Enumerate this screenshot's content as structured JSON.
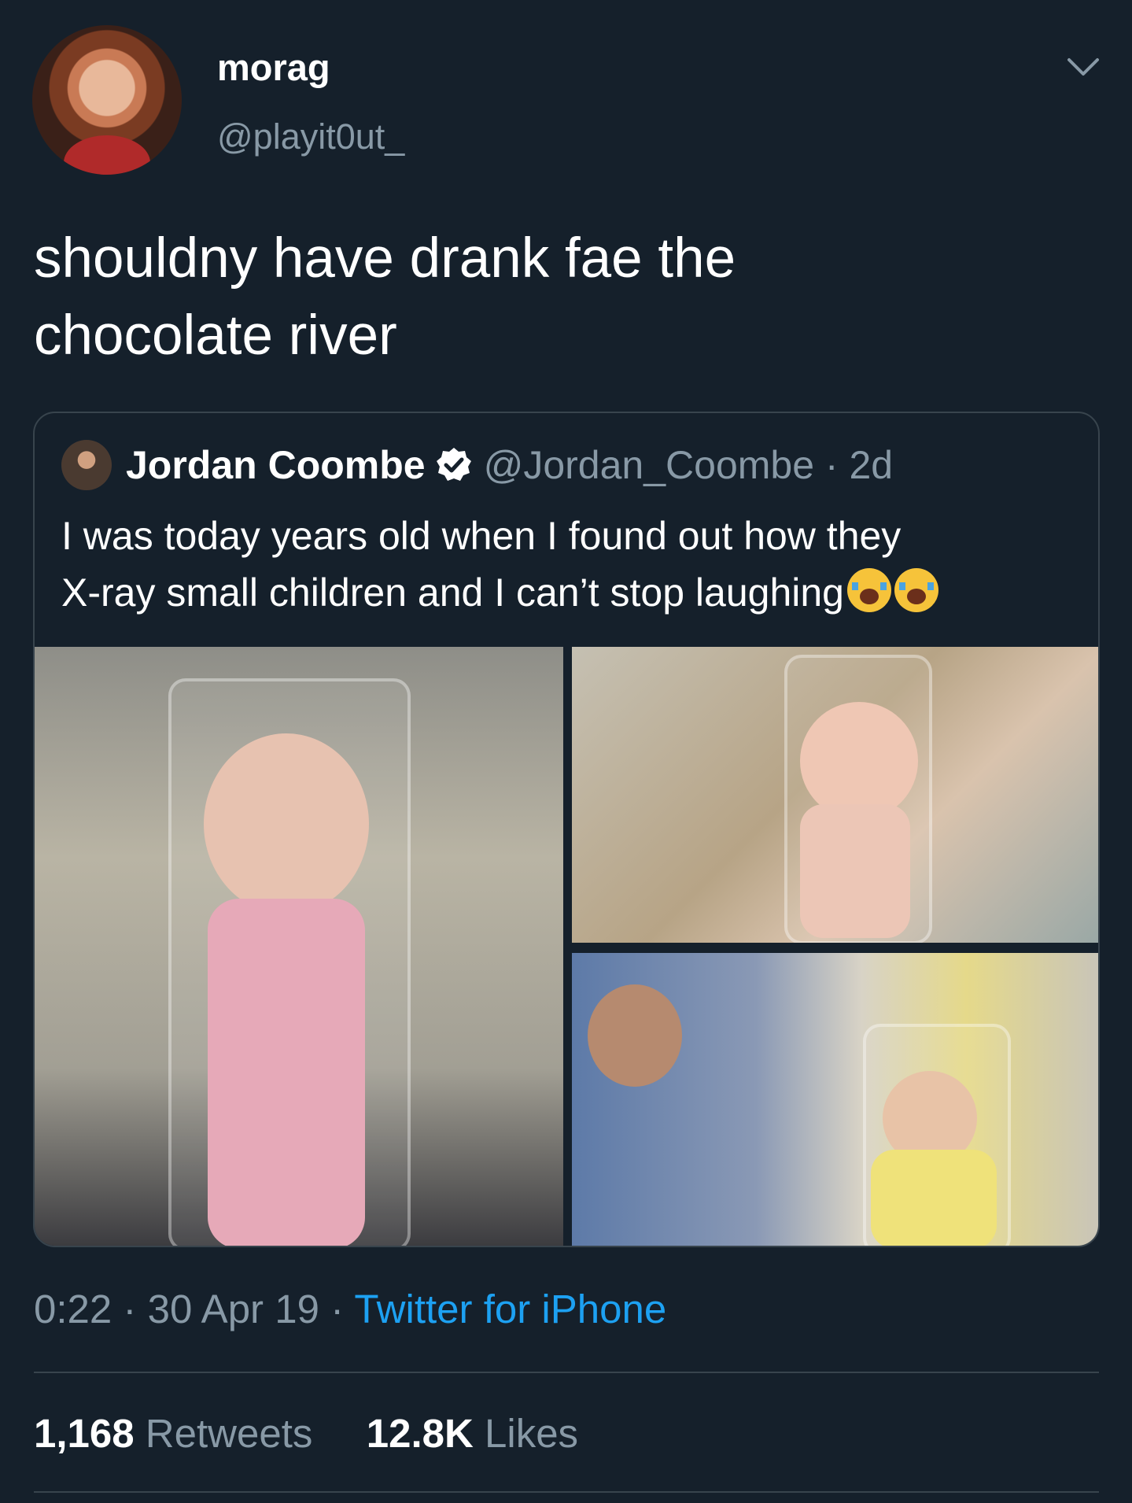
{
  "tweet": {
    "display_name": "morag",
    "handle": "@playit0ut_",
    "text_line1": "shouldny have drank fae the",
    "text_line2": "chocolate river",
    "menu_icon": "chevron-down-icon"
  },
  "quoted_tweet": {
    "display_name": "Jordan Coombe",
    "verified_icon": "verified-badge-icon",
    "handle_time": "@Jordan_Coombe · 2d",
    "text_line1": "I was today years old when I found out how they",
    "text_line2": "X-ray small children and I can’t stop laughing",
    "emoji_name": "loudly-crying-face-emoji",
    "media_count": 3
  },
  "meta": {
    "time": "0:22",
    "sep1": " · ",
    "date": "30 Apr 19",
    "sep2": " · ",
    "source": "Twitter for iPhone"
  },
  "stats": {
    "retweets_count": "1,168",
    "retweets_label": "Retweets",
    "likes_count": "12.8K",
    "likes_label": "Likes"
  },
  "colors": {
    "background": "#15202b",
    "secondary_text": "#8899a6",
    "link": "#1da1f2",
    "border": "#38444d"
  }
}
